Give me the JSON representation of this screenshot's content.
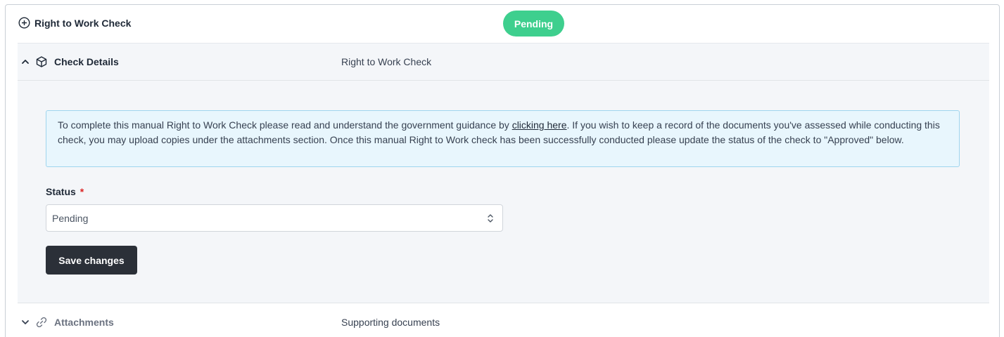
{
  "header": {
    "title": "Right to Work Check",
    "title_icon": "plus-circle-icon",
    "status_badge": "Pending",
    "badge_color": "#3ecf8e"
  },
  "check_details": {
    "label": "Check Details",
    "description": "Right to Work Check",
    "chevron_icon": "chevron-up-icon",
    "icon": "cube-icon"
  },
  "alert": {
    "text_before_link": "To complete this manual Right to Work Check please read and understand the government guidance by ",
    "link_text": "clicking here",
    "text_after_link": ". If you wish to keep a record of the documents you've assessed while conducting this check, you may upload copies under the attachments section. Once this manual Right to Work check has been successfully conducted please update the status of the check to \"Approved\" below."
  },
  "form": {
    "status_label": "Status",
    "required_marker": "*",
    "status_value": "Pending",
    "save_label": "Save changes"
  },
  "attachments": {
    "label": "Attachments",
    "description": "Supporting documents",
    "chevron_icon": "chevron-down-icon",
    "icon": "link-icon"
  }
}
